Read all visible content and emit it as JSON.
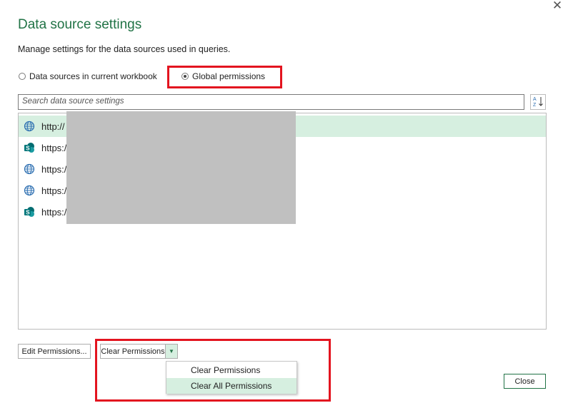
{
  "dialog": {
    "title": "Data source settings",
    "subtitle": "Manage settings for the data sources used in queries.",
    "close_icon": "close-icon"
  },
  "scope": {
    "options": [
      {
        "label": "Data sources in current workbook",
        "selected": false
      },
      {
        "label": "Global permissions",
        "selected": true
      }
    ]
  },
  "search": {
    "placeholder": "Search data source settings",
    "sort_icon": "sort-az-icon"
  },
  "sources": [
    {
      "text": "http://",
      "icon": "globe-icon",
      "selected": true
    },
    {
      "text": "https:/",
      "icon": "sharepoint-icon",
      "selected": false
    },
    {
      "text": "https:/",
      "icon": "globe-icon",
      "selected": false
    },
    {
      "text": "https:/",
      "icon": "globe-icon",
      "selected": false
    },
    {
      "text": "https:/",
      "icon": "sharepoint-icon",
      "selected": false
    }
  ],
  "footer": {
    "edit_label": "Edit Permissions...",
    "clear_label": "Clear Permissions",
    "close_label": "Close"
  },
  "clear_menu": {
    "items": [
      {
        "label": "Clear Permissions",
        "highlighted": false
      },
      {
        "label": "Clear All Permissions",
        "highlighted": true
      }
    ]
  },
  "colors": {
    "accent": "#217346",
    "selection": "#d6efe0",
    "highlight_box": "#e3141f",
    "redaction": "#c0c0c0"
  }
}
